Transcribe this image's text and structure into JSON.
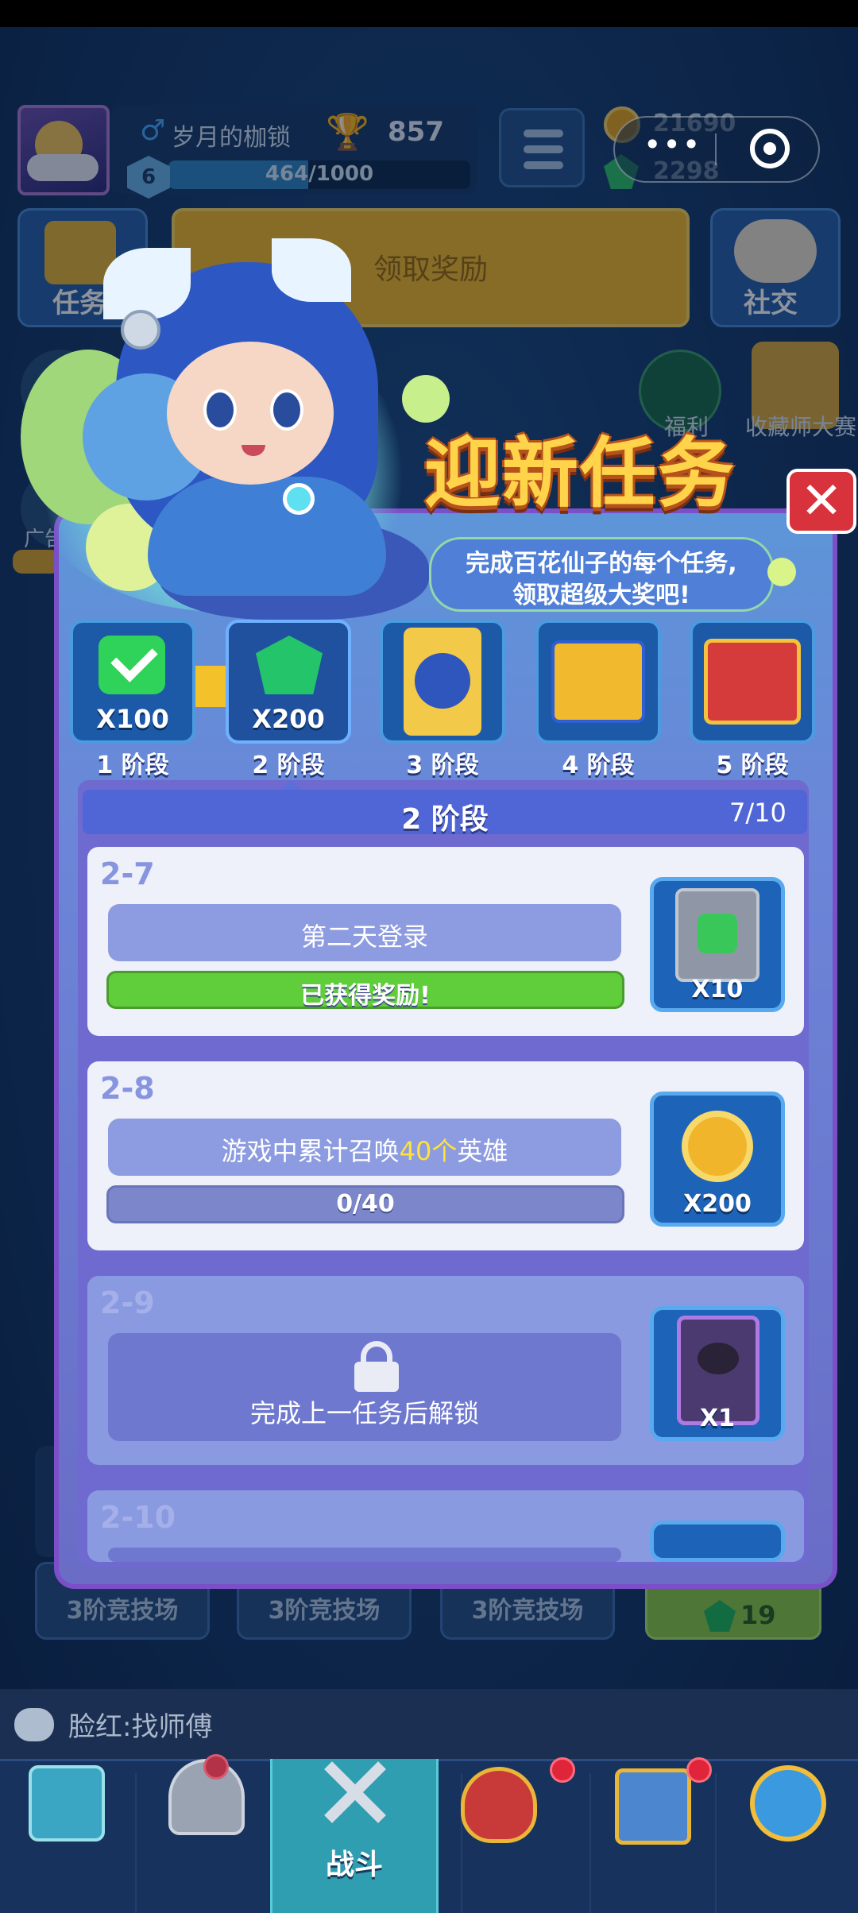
{
  "hud": {
    "player_name": "岁月的枷锁",
    "trophies": "857",
    "level": "6",
    "xp": "464/1000",
    "xp_fraction": 0.464,
    "coins": "21690",
    "gems": "2298"
  },
  "row2": {
    "task_label": "任务",
    "claim_label": "领取奖励",
    "social_label": "社交",
    "welfare_label": "福利",
    "contest_label": "收藏师大赛",
    "ad_label": "广告"
  },
  "popup": {
    "title": "迎新任务",
    "close_label": "✕",
    "subtitle_line1": "完成百花仙子的每个任务,",
    "subtitle_line2": "领取超级大奖吧!",
    "stages": [
      {
        "label": "1 阶段",
        "qty": "X100",
        "icon": "check-icon"
      },
      {
        "label": "2 阶段",
        "qty": "X200",
        "icon": "gem-icon"
      },
      {
        "label": "3 阶段",
        "qty": "",
        "icon": "hero-card-icon"
      },
      {
        "label": "4 阶段",
        "qty": "",
        "icon": "gold-chest-icon"
      },
      {
        "label": "5 阶段",
        "qty": "",
        "icon": "red-chest-icon"
      }
    ],
    "section_title": "2 阶段",
    "section_progress": "7/10",
    "tasks": [
      {
        "id": "2-7",
        "desc": "第二天登录",
        "bar_text": "已获得奖励!",
        "reward_qty": "X10",
        "reward_icon": "card-check-icon"
      },
      {
        "id": "2-8",
        "desc_pre": "游戏中累计召唤",
        "desc_hl": "40个",
        "desc_post": "英雄",
        "bar_text": "0/40",
        "progress": 0,
        "reward_qty": "X200",
        "reward_icon": "coin-icon"
      },
      {
        "id": "2-9",
        "locked_text": "完成上一任务后解锁",
        "reward_qty": "X1",
        "reward_icon": "hooded-hero-icon"
      },
      {
        "id": "2-10"
      }
    ]
  },
  "arena": {
    "label": "3阶竞技场",
    "gem_count": "19"
  },
  "chat": {
    "text": "脸红:找师傅"
  },
  "nav": {
    "battle_label": "战斗"
  },
  "capsule": {
    "dots": "•••"
  },
  "colors": {
    "title": "#ffd34a",
    "highlight": "#ffe23a",
    "done_bar": "#5fce3a",
    "close": "#d8333c"
  }
}
